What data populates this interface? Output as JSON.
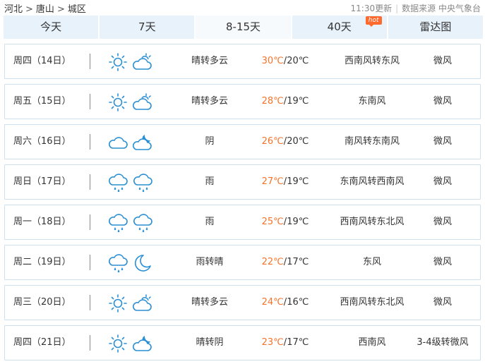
{
  "breadcrumb": {
    "items": [
      "河北",
      "唐山",
      "城区"
    ],
    "separator": ">"
  },
  "meta": {
    "update_time": "11:30更新",
    "source": "数据来源 中央气象台"
  },
  "tabs": [
    {
      "label": "今天"
    },
    {
      "label": "7天"
    },
    {
      "label": "8-15天",
      "active": true
    },
    {
      "label": "40天",
      "badge": "hot"
    },
    {
      "label": "雷达图"
    }
  ],
  "colors": {
    "accent": "#2a8fd4",
    "high_temp": "#f4732b",
    "tab_bg": "#e7f2fb",
    "hot_badge": "#ff6a2f",
    "row_border": "#cfe0ee"
  },
  "days": [
    {
      "date": "周四（14日）",
      "icon1": "sun-icon",
      "icon2": "partly-cloudy-icon",
      "condition": "晴转多云",
      "high": "30℃",
      "low": "20℃",
      "wind_dir": "西南风转东风",
      "wind_level": "微风"
    },
    {
      "date": "周五（15日）",
      "icon1": "sun-icon",
      "icon2": "partly-cloudy-icon",
      "condition": "晴转多云",
      "high": "28℃",
      "low": "19℃",
      "wind_dir": "东南风",
      "wind_level": "微风"
    },
    {
      "date": "周六（16日）",
      "icon1": "cloud-icon",
      "icon2": "cloud-moon-icon",
      "condition": "阴",
      "high": "26℃",
      "low": "20℃",
      "wind_dir": "南风转东南风",
      "wind_level": "微风"
    },
    {
      "date": "周日（17日）",
      "icon1": "rain-icon",
      "icon2": "rain-icon",
      "condition": "雨",
      "high": "27℃",
      "low": "19℃",
      "wind_dir": "东南风转西南风",
      "wind_level": "微风"
    },
    {
      "date": "周一（18日）",
      "icon1": "rain-icon",
      "icon2": "rain-icon",
      "condition": "雨",
      "high": "25℃",
      "low": "19℃",
      "wind_dir": "西南风转东北风",
      "wind_level": "微风"
    },
    {
      "date": "周二（19日）",
      "icon1": "rain-icon",
      "icon2": "moon-icon",
      "condition": "雨转晴",
      "high": "22℃",
      "low": "17℃",
      "wind_dir": "东风",
      "wind_level": "微风"
    },
    {
      "date": "周三（20日）",
      "icon1": "sun-icon",
      "icon2": "partly-cloudy-icon",
      "condition": "晴转多云",
      "high": "24℃",
      "low": "16℃",
      "wind_dir": "西南风转东北风",
      "wind_level": "微风"
    },
    {
      "date": "周四（21日）",
      "icon1": "sun-icon",
      "icon2": "cloud-moon-icon",
      "condition": "晴转阴",
      "high": "23℃",
      "low": "17℃",
      "wind_dir": "西南风",
      "wind_level": "3-4级转微风"
    }
  ]
}
